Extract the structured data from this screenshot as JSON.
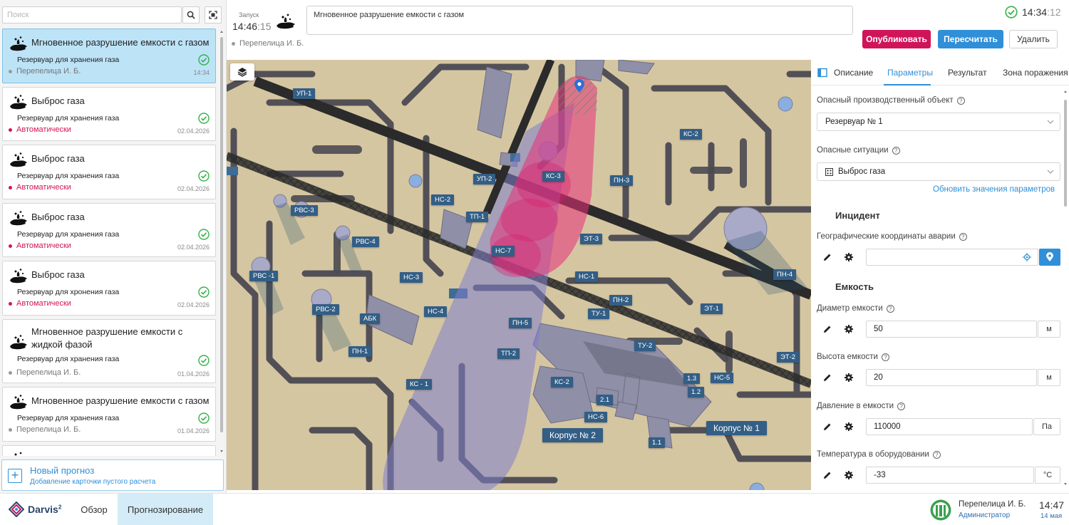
{
  "sidebar": {
    "search_placeholder": "Поиск",
    "cards": [
      {
        "title": "Мгновенное разрушение емкости с газом",
        "subtitle": "Резервуар для хранения газа",
        "author": "Перепелица И. Б.",
        "date": "14:34",
        "active": true
      },
      {
        "title": "Выброс газа",
        "subtitle": "Резервуар для хранения газа",
        "author": "Автоматически",
        "date": "02.04.2026"
      },
      {
        "title": "Выброс газа",
        "subtitle": "Резервуар для хранения газа",
        "author": "Автоматически",
        "date": "02.04.2026"
      },
      {
        "title": "Выброс газа",
        "subtitle": "Резервуар для хранения газа",
        "author": "Автоматически",
        "date": "02.04.2026"
      },
      {
        "title": "Выброс газа",
        "subtitle": "Резервуар для хронения газа",
        "author": "Автоматически",
        "date": "02.04.2026"
      },
      {
        "title": "Мгновенное разрушение емкости с жидкой фазой",
        "subtitle": "Резервуар для хранения газа",
        "author": "Перепелица И. Б.",
        "date": "01.04.2026"
      },
      {
        "title": "Мгновенное разрушение емкости с газом",
        "subtitle": "Резервуар для хранения газа",
        "author": "Перепелица И. Б.",
        "date": "01.04.2026"
      }
    ],
    "new_forecast": {
      "title": "Новый прогноз",
      "subtitle": "Добавление карточки пустого расчета"
    }
  },
  "header": {
    "launch_label": "Запуск",
    "launch_time_hm": "14:46",
    "launch_time_s": ":15",
    "scenario_title": "Мгновенное разрушение емкости с газом",
    "author": "Перепелица И. Б.",
    "clock_hm": "14:34",
    "clock_s": ":12",
    "publish_label": "Опубликовать",
    "recalc_label": "Пересчитать",
    "delete_label": "Удалить"
  },
  "map": {
    "labels": [
      "УП-1",
      "УП-2",
      "КС-2",
      "КС-3",
      "ПН-3",
      "НС-2",
      "ТП-1",
      "РВС-3",
      "РВС-4",
      "РВС -1",
      "РВС-2",
      "НС-7",
      "ЭТ-3",
      "НС-1",
      "ПН-4",
      "НС-3",
      "НС-4",
      "ПН-2",
      "ТУ-1",
      "ЭТ-1",
      "АБК",
      "ПН-5",
      "ТУ-2",
      "ЭТ-2",
      "ПН-1",
      "ТП-2",
      "1.3",
      "НС-5",
      "1.2",
      "КС-2",
      "КС - 1",
      "2.1",
      "НС-6",
      "Корпус № 2",
      "Корпус № 1",
      "1.1"
    ]
  },
  "panel": {
    "tabs": [
      "Описание",
      "Параметры",
      "Результат",
      "Зона поражения"
    ],
    "active_tab": "Параметры",
    "hazard_object_label": "Опасный производственный объект",
    "hazard_object_value": "Резервуар № 1",
    "hazard_situation_label": "Опасные ситуации",
    "hazard_situation_value": "Выброс газа",
    "update_link": "Обновить значения параметров",
    "section_incident": "Инцидент",
    "coords_label": "Географические координаты аварии",
    "coords_value": "",
    "section_tank": "Емкость",
    "diameter_label": "Диаметр емкости",
    "diameter_value": "50",
    "diameter_unit": "м",
    "height_label": "Высота емкости",
    "height_value": "20",
    "height_unit": "м",
    "pressure_label": "Давление в емкости",
    "pressure_value": "110000",
    "pressure_unit": "Па",
    "temperature_label": "Температура в оборудовании",
    "temperature_value": "-33",
    "temperature_unit": "°C"
  },
  "footer": {
    "logo": "Darvis",
    "logo_sup": "2",
    "nav_overview": "Обзор",
    "nav_forecast": "Прогнозирование",
    "user_name": "Перепелица И. Б.",
    "user_role": "Администратор",
    "time": "14:47",
    "date": "14 мая"
  },
  "colors": {
    "accent": "#2f8fd8",
    "publish": "#d0145a",
    "auto_author": "#d4145a",
    "active_card": "#bde3f7"
  }
}
